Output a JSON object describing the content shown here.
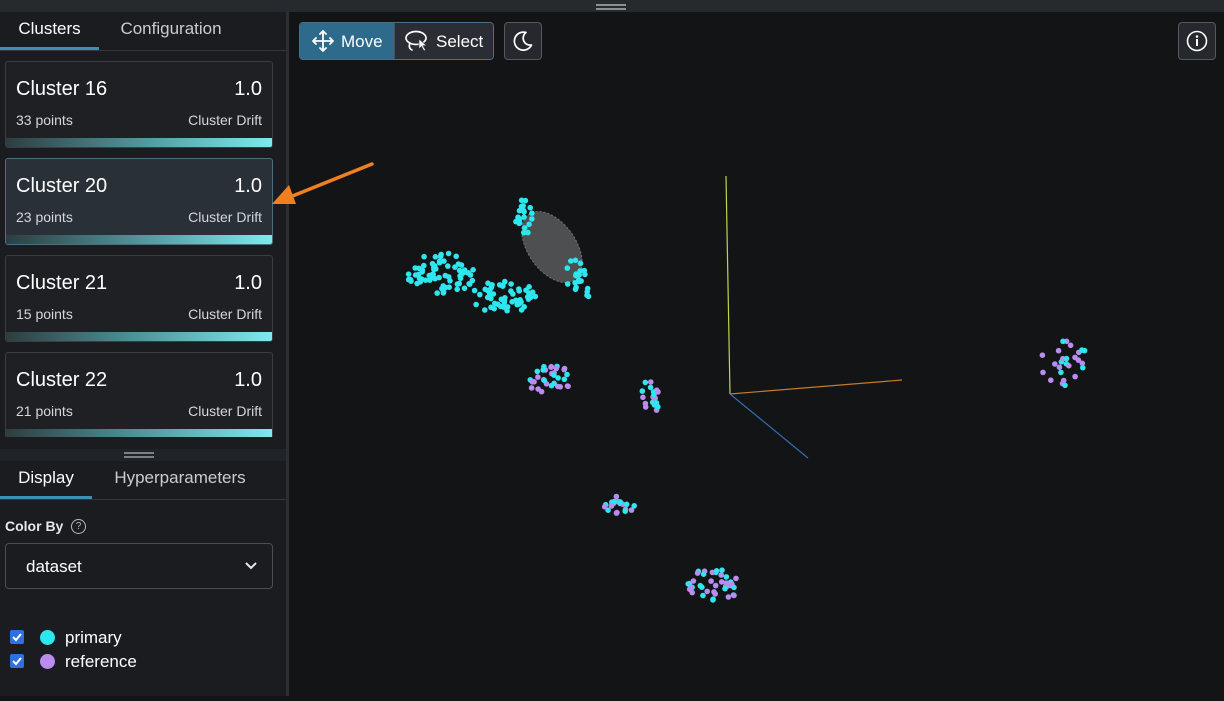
{
  "cluster_tabs": [
    {
      "label": "Clusters",
      "active": true
    },
    {
      "label": "Configuration",
      "active": false
    }
  ],
  "clusters": [
    {
      "name": "Cluster 16",
      "value": "1.0",
      "points": "33 points",
      "metric_label": "Cluster Drift",
      "drift": 1.0,
      "selected": false
    },
    {
      "name": "Cluster 20",
      "value": "1.0",
      "points": "23 points",
      "metric_label": "Cluster Drift",
      "drift": 1.0,
      "selected": true
    },
    {
      "name": "Cluster 21",
      "value": "1.0",
      "points": "15 points",
      "metric_label": "Cluster Drift",
      "drift": 1.0,
      "selected": false
    },
    {
      "name": "Cluster 22",
      "value": "1.0",
      "points": "21 points",
      "metric_label": "Cluster Drift",
      "drift": 1.0,
      "selected": false
    }
  ],
  "display_tabs": [
    {
      "label": "Display",
      "active": true
    },
    {
      "label": "Hyperparameters",
      "active": false
    }
  ],
  "color_by": {
    "label": "Color By",
    "value": "dataset"
  },
  "legend": [
    {
      "label": "primary",
      "color": "#2ee6ee",
      "checked": true
    },
    {
      "label": "reference",
      "color": "#b98cf0",
      "checked": true
    }
  ],
  "toolbar": {
    "move_label": "Move",
    "select_label": "Select",
    "active_mode": "move",
    "theme_icon": "moon-icon",
    "info_icon": "info-icon"
  },
  "colors": {
    "primary": "#2ee6ee",
    "reference": "#b98cf0",
    "accent": "#2d6a8c",
    "annotation_arrow": "#f0801f"
  }
}
